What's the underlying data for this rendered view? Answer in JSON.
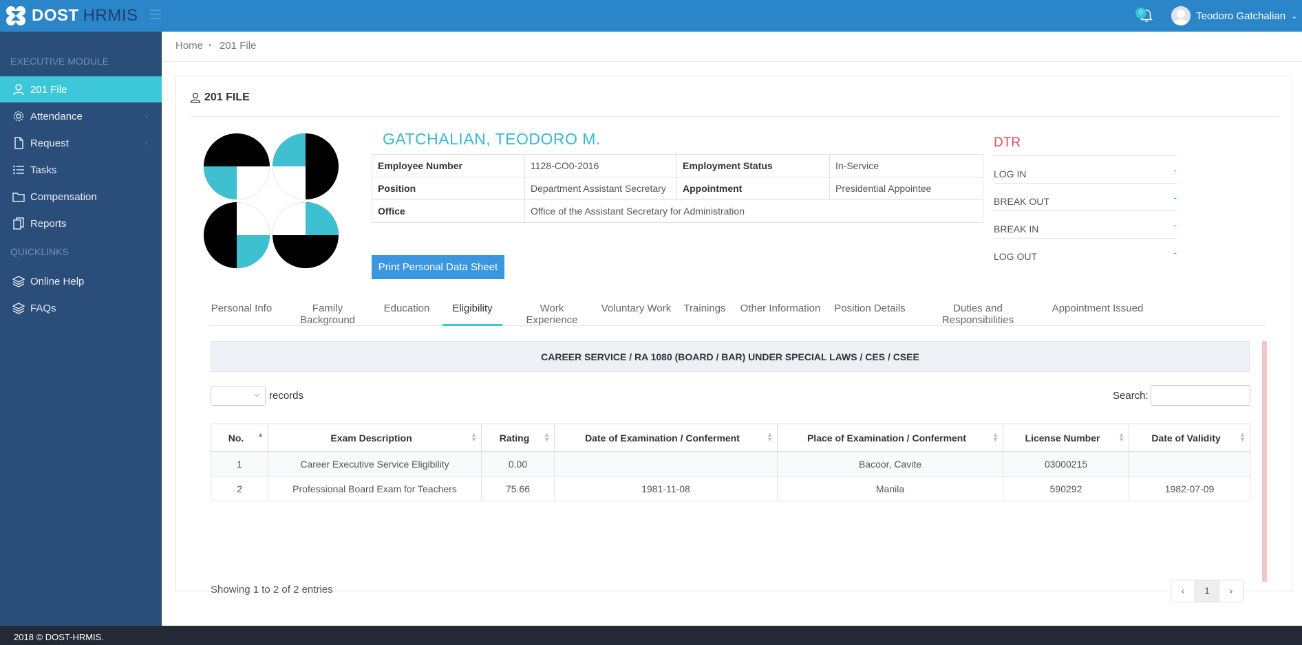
{
  "topbar": {
    "brand_primary": "DOST",
    "brand_secondary": "HRMIS",
    "notification_count": "0",
    "user_name": "Teodoro Gatchalian"
  },
  "sidebar": {
    "section_executive": "EXECUTIVE MODULE",
    "section_quicklinks": "QUICKLINKS",
    "items": [
      {
        "label": "201 File",
        "icon": "user-icon"
      },
      {
        "label": "Attendance",
        "icon": "gear-icon"
      },
      {
        "label": "Request",
        "icon": "file-icon"
      },
      {
        "label": "Tasks",
        "icon": "list-icon"
      },
      {
        "label": "Compensation",
        "icon": "folder-icon"
      },
      {
        "label": "Reports",
        "icon": "copy-icon"
      },
      {
        "label": "Online Help",
        "icon": "layers-icon"
      },
      {
        "label": "FAQs",
        "icon": "layers-icon"
      }
    ]
  },
  "breadcrumb": {
    "home": "Home",
    "current": "201 File"
  },
  "panel": {
    "title": "201 FILE"
  },
  "employee": {
    "name": "GATCHALIAN, TEODORO M.",
    "employee_number_label": "Employee Number",
    "employee_number": "1128-CO0-2016",
    "employment_status_label": "Employment Status",
    "employment_status": "In-Service",
    "position_label": "Position",
    "position": "Department Assistant Secretary",
    "appointment_label": "Appointment",
    "appointment": "Presidential Appointee",
    "office_label": "Office",
    "office": "Office of the Assistant Secretary for Administration",
    "print_button": "Print Personal Data Sheet"
  },
  "dtr": {
    "title": "DTR",
    "rows": [
      {
        "label": "LOG IN",
        "value": "-"
      },
      {
        "label": "BREAK OUT",
        "value": "-"
      },
      {
        "label": "BREAK IN",
        "value": "-"
      },
      {
        "label": "LOG OUT",
        "value": "-"
      }
    ]
  },
  "tabs": [
    "Personal Info",
    "Family Background",
    "Education",
    "Eligibility",
    "Work Experience",
    "Voluntary Work",
    "Trainings",
    "Other Information",
    "Position Details",
    "Duties and Responsibilities",
    "Appointment Issued"
  ],
  "active_tab": "Eligibility",
  "eligibility": {
    "section_title": "CAREER SERVICE / RA 1080 (BOARD / BAR) UNDER SPECIAL LAWS / CES / CSEE",
    "length_value": "",
    "records_label": "records",
    "search_label": "Search:",
    "search_value": "",
    "columns": [
      "No.",
      "Exam Description",
      "Rating",
      "Date of Examination / Conferment",
      "Place of Examination / Conferment",
      "License Number",
      "Date of Validity"
    ],
    "rows": [
      [
        "1",
        "Career Executive Service Eligibility",
        "0.00",
        "",
        "Bacoor, Cavite",
        "03000215",
        ""
      ],
      [
        "2",
        "Professional Board Exam for Teachers",
        "75.66",
        "1981-11-08",
        "Manila",
        "590292",
        "1982-07-09"
      ]
    ],
    "showing": "Showing 1 to 2 of 2 entries",
    "pager": {
      "prev": "‹",
      "current": "1",
      "next": "›"
    }
  },
  "footer": {
    "text": "2018 © DOST-HRMIS."
  },
  "colors": {
    "topbar": "#2a86c9",
    "sidebar": "#2b4d7a",
    "active_item": "#3cc8d8",
    "name_accent": "#3cb7cf",
    "dtr_title": "#e04a5b",
    "button": "#3a97df"
  }
}
